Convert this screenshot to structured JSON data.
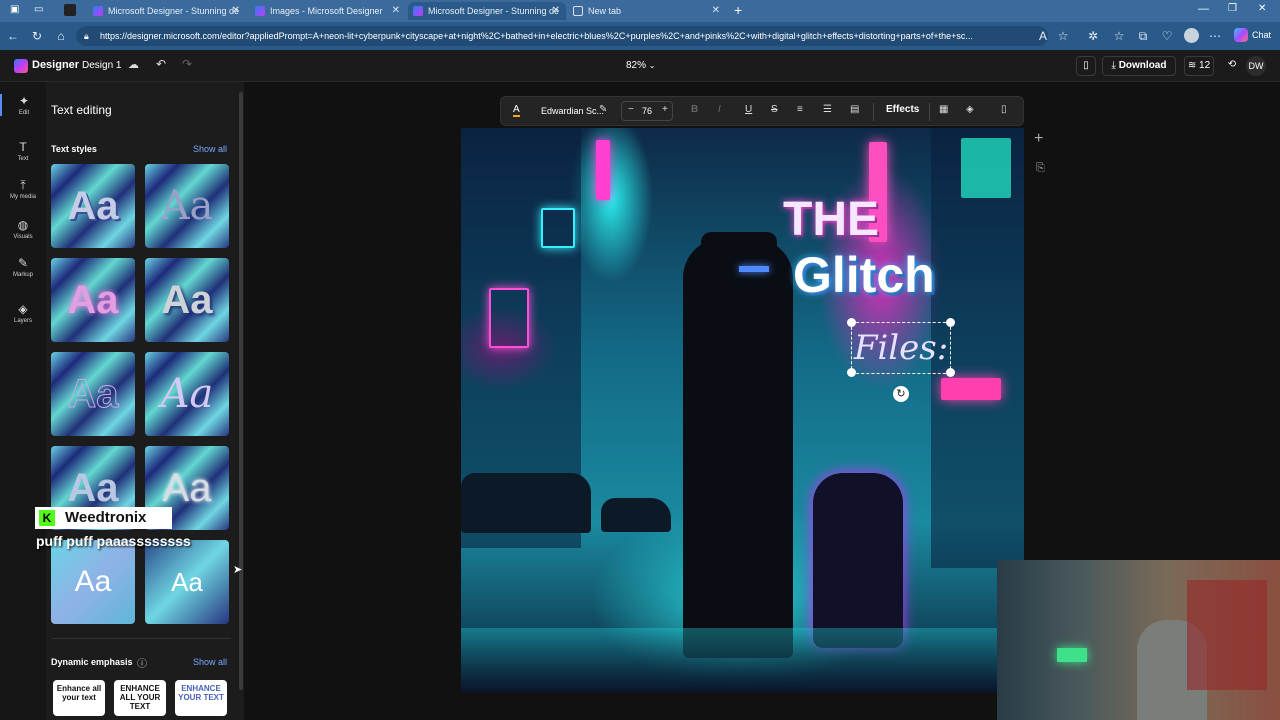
{
  "browser": {
    "tabs": [
      {
        "label": "Microsoft Designer - Stunning de"
      },
      {
        "label": "Images - Microsoft Designer"
      },
      {
        "label": "Microsoft Designer - Stunning de"
      },
      {
        "label": "New tab"
      }
    ],
    "url": "https://designer.microsoft.com/editor?appliedPrompt=A+neon-lit+cyberpunk+cityscape+at+night%2C+bathed+in+electric+blues%2C+purples%2C+and+pinks%2C+with+digital+glitch+effects+distorting+parts+of+the+sc...",
    "chat_label": "Chat"
  },
  "designer": {
    "app_name": "Designer",
    "doc_name": "Design 1",
    "zoom": "82%",
    "download_label": "Download",
    "credits": "12",
    "user_initials": "DW"
  },
  "rail": [
    {
      "label": "Edit",
      "icon": "sparkle-icon"
    },
    {
      "label": "Text",
      "icon": "text-icon"
    },
    {
      "label": "My media",
      "icon": "upload-icon"
    },
    {
      "label": "Visuals",
      "icon": "shapes-icon"
    },
    {
      "label": "Markup",
      "icon": "pen-icon"
    },
    {
      "label": "Layers",
      "icon": "layers-icon"
    }
  ],
  "panel": {
    "title": "Text editing",
    "text_styles_label": "Text styles",
    "show_all": "Show all",
    "style_glyph": "Aa",
    "dynamic_label": "Dynamic emphasis",
    "emphasis": [
      "Enhance all your text",
      "ENHANCE ALL YOUR TEXT",
      "ENHANCE YOUR TEXT"
    ]
  },
  "toolbar": {
    "font": "Edwardian Sc...",
    "size": "76",
    "effects": "Effects"
  },
  "canvas": {
    "line1": "THE",
    "line2": "Glitch",
    "line3": "Files:"
  },
  "overlay": {
    "stream_name": "Weedtronix",
    "chat_message": "puff puff paaassssssss"
  },
  "colors": {
    "accent": "#5b8cff",
    "neon_pink": "#ff4fd8",
    "neon_cyan": "#2af0f0"
  }
}
